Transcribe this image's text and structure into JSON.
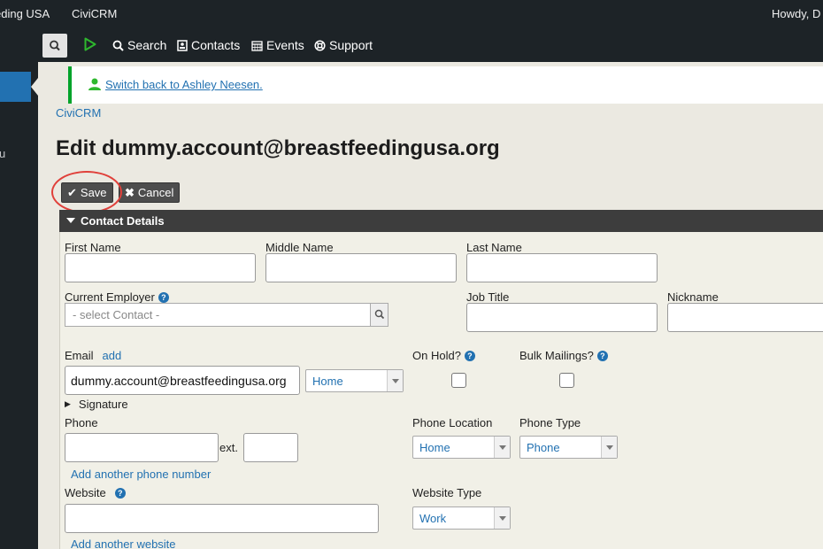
{
  "wp_bar": {
    "site_name": "eding USA",
    "app_name": "CiviCRM",
    "greeting": "Howdy, D"
  },
  "sidebar": {
    "partial_label": "u"
  },
  "civi_menu": {
    "items": [
      {
        "label": "Search",
        "icon": "search-icon"
      },
      {
        "label": "Contacts",
        "icon": "contact-card-icon"
      },
      {
        "label": "Events",
        "icon": "calendar-icon"
      },
      {
        "label": "Support",
        "icon": "lifebuoy-icon"
      }
    ]
  },
  "notice": {
    "link_text": "Switch back to Ashley Neesen."
  },
  "breadcrumb": "CiviCRM",
  "page_title": "Edit dummy.account@breastfeedingusa.org",
  "buttons": {
    "save": "Save",
    "cancel": "Cancel"
  },
  "section": {
    "title": "Contact Details",
    "first_name": {
      "label": "First Name",
      "value": ""
    },
    "middle_name": {
      "label": "Middle Name",
      "value": ""
    },
    "last_name": {
      "label": "Last Name",
      "value": ""
    },
    "current_employer": {
      "label": "Current Employer",
      "placeholder": "- select Contact -"
    },
    "job_title": {
      "label": "Job Title",
      "value": ""
    },
    "nickname": {
      "label": "Nickname",
      "value": ""
    },
    "email": {
      "label": "Email",
      "add_link": "add",
      "value": "dummy.account@breastfeedingusa.org",
      "location": "Home"
    },
    "on_hold": {
      "label": "On Hold?"
    },
    "bulk_mailings": {
      "label": "Bulk Mailings?"
    },
    "signature": "Signature",
    "phone": {
      "label": "Phone",
      "ext_label": "ext.",
      "add_link": "Add another phone number"
    },
    "phone_location": {
      "label": "Phone Location",
      "value": "Home"
    },
    "phone_type": {
      "label": "Phone Type",
      "value": "Phone"
    },
    "website": {
      "label": "Website",
      "add_link": "Add another website"
    },
    "website_type": {
      "label": "Website Type",
      "value": "Work"
    }
  },
  "colors": {
    "link": "#2271b1",
    "admin_bar": "#1d2327",
    "notice_border": "#00a32a",
    "highlight_ring": "#e0403a"
  }
}
